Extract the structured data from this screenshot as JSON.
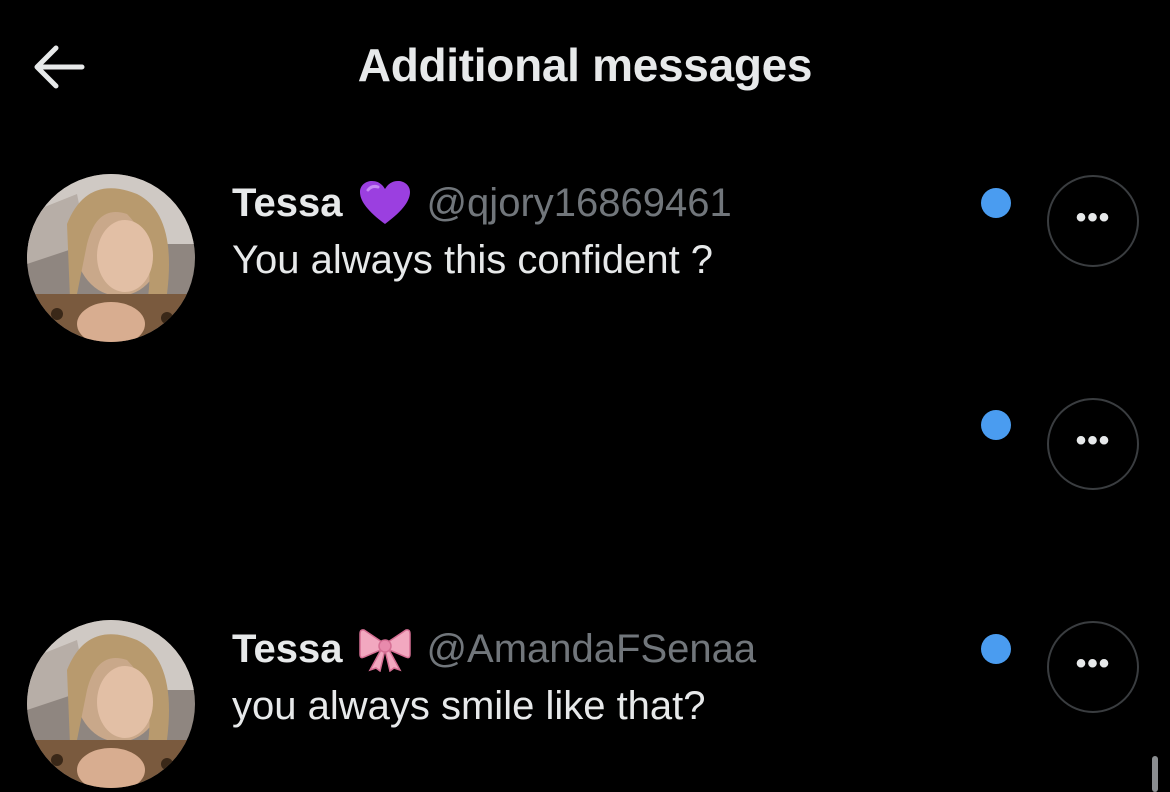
{
  "header": {
    "title": "Additional messages",
    "back_icon": "arrow-left-icon"
  },
  "messages": [
    {
      "display_name": "Tessa",
      "emoji": "purple-heart-icon",
      "handle": "@qjory16869461",
      "text": "You always this confident ?",
      "unread": true
    },
    {
      "display_name": "",
      "emoji": "",
      "handle": "",
      "text": "",
      "unread": true
    },
    {
      "display_name": "Tessa",
      "emoji": "pink-ribbon-icon",
      "handle": "@AmandaFSenaa",
      "text": "you always smile like that?",
      "unread": true
    }
  ],
  "more_label": "•••",
  "colors": {
    "background": "#000000",
    "primary_text": "#e7e9ea",
    "secondary_text": "#71767b",
    "unread_dot": "#4a9cf0",
    "button_border": "#3a3d40"
  }
}
